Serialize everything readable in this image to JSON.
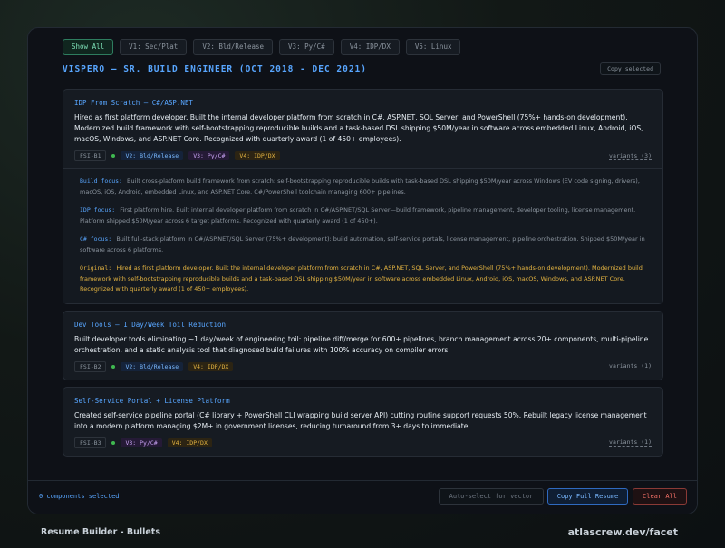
{
  "filters": [
    "Show All",
    "V1: Sec/Plat",
    "V2: Bld/Release",
    "V3: Py/C#",
    "V4: IDP/DX",
    "V5: Linux"
  ],
  "role_title": "VISPERO — SR. BUILD ENGINEER (OCT 2018 - DEC 2021)",
  "copy_selected": "Copy selected",
  "cards": [
    {
      "title": "IDP From Scratch — C#/ASP.NET",
      "body": "Hired as first platform developer. Built the internal developer platform from scratch in C#, ASP.NET, SQL Server, and PowerShell (75%+ hands-on development). Modernized build framework with self-bootstrapping reproducible builds and a task-based DSL shipping $50M/year in software across embedded Linux, Android, iOS, macOS, Windows, and ASP.NET Core. Recognized with quarterly award (1 of 450+ employees).",
      "id": "FSI-B1",
      "tags": [
        "V2: Bld/Release",
        "V3: Py/C#",
        "V4: IDP/DX"
      ],
      "variants": "variants (3)",
      "variant_rows": [
        {
          "label": "Build focus:",
          "text": "Built cross-platform build framework from scratch: self-bootstrapping reproducible builds with task-based DSL shipping $50M/year across Windows (EV code signing, drivers), macOS, iOS, Android, embedded Linux, and ASP.NET Core. C#/PowerShell toolchain managing 600+ pipelines."
        },
        {
          "label": "IDP focus:",
          "text": "First platform hire. Built internal developer platform from scratch in C#/ASP.NET/SQL Server—build framework, pipeline management, developer tooling, license management. Platform shipped $50M/year across 6 target platforms. Recognized with quarterly award (1 of 450+)."
        },
        {
          "label": "C# focus:",
          "text": "Built full-stack platform in C#/ASP.NET/SQL Server (75%+ development): build automation, self-service portals, license management, pipeline orchestration. Shipped $50M/year in software across 6 platforms."
        },
        {
          "label": "Original:",
          "text": "Hired as first platform developer. Built the internal developer platform from scratch in C#, ASP.NET, SQL Server, and PowerShell (75%+ hands-on development). Modernized build framework with self-bootstrapping reproducible builds and a task-based DSL shipping $50M/year in software across embedded Linux, Android, iOS, macOS, Windows, and ASP.NET Core. Recognized with quarterly award (1 of 450+ employees)."
        }
      ]
    },
    {
      "title": "Dev Tools — 1 Day/Week Toil Reduction",
      "body": "Built developer tools eliminating ~1 day/week of engineering toil: pipeline diff/merge for 600+ pipelines, branch management across 20+ components, multi-pipeline orchestration, and a static analysis tool that diagnosed build failures with 100% accuracy on compiler errors.",
      "id": "FSI-B2",
      "tags": [
        "V2: Bld/Release",
        "V4: IDP/DX"
      ],
      "variants": "variants (1)"
    },
    {
      "title": "Self-Service Portal + License Platform",
      "body": "Created self-service pipeline portal (C# library + PowerShell CLI wrapping build server API) cutting routine support requests 50%. Rebuilt legacy license management into a modern platform managing $2M+ in government licenses, reducing turnaround from 3+ days to immediate.",
      "id": "FSI-B3",
      "tags": [
        "V3: Py/C#",
        "V4: IDP/DX"
      ],
      "variants": "variants (1)"
    }
  ],
  "footer": {
    "selected": "0 components selected",
    "auto_select": "Auto-select for vector",
    "copy_full": "Copy Full Resume",
    "clear": "Clear All"
  },
  "caption_left": "Resume Builder - Bullets",
  "caption_right": "atlascrew.dev/facet",
  "colors": {
    "accent_blue": "#58a6ff",
    "accent_green": "#7ee0b8",
    "original_gold": "#e3b341",
    "danger": "#f47067"
  }
}
